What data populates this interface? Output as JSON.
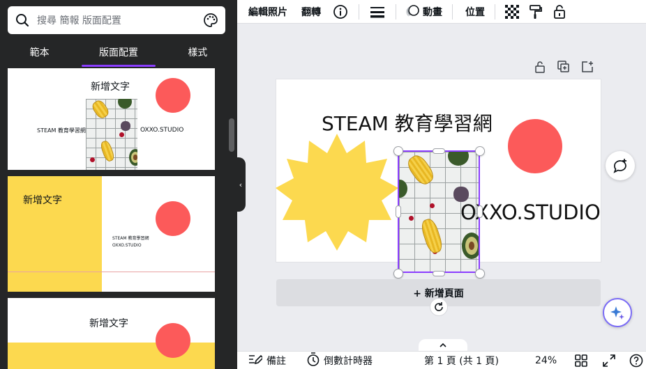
{
  "search": {
    "placeholder": "搜尋 簡報 版面配置"
  },
  "tabs": [
    {
      "label": "範本"
    },
    {
      "label": "版面配置"
    },
    {
      "label": "樣式"
    }
  ],
  "templates": [
    {
      "heading": "新增文字",
      "title": "STEAM 教育學習網",
      "subtitle": "OXXO.STUDIO"
    },
    {
      "heading": "新增文字",
      "title": "STEAM 教育學習網",
      "subtitle": "OXXO.STUDIO"
    },
    {
      "heading": "新增文字"
    }
  ],
  "toolbar": {
    "edit_photo": "編輯照片",
    "flip": "翻轉",
    "animate": "動畫",
    "position": "位置"
  },
  "canvas": {
    "title": "STEAM 教育學習網",
    "subtitle": "OXXO.STUDIO",
    "add_page": "+ 新增頁面"
  },
  "bottom": {
    "notes": "備註",
    "timer": "倒數計時器",
    "page_indicator": "第 1 頁 (共 1 頁)",
    "zoom": "24%"
  },
  "colors": {
    "accent": "#8b3dff",
    "sun_yellow": "#fcd94f",
    "circle_red": "#fc5a5a",
    "panel_bg": "#252627"
  },
  "icons": {
    "search": "search-icon",
    "palette": "palette-icon",
    "info": "info-icon",
    "lines": "line-style-icon",
    "animate": "animate-icon",
    "transparency": "transparency-icon",
    "paint": "paint-roller-icon",
    "lock": "lock-icon"
  }
}
